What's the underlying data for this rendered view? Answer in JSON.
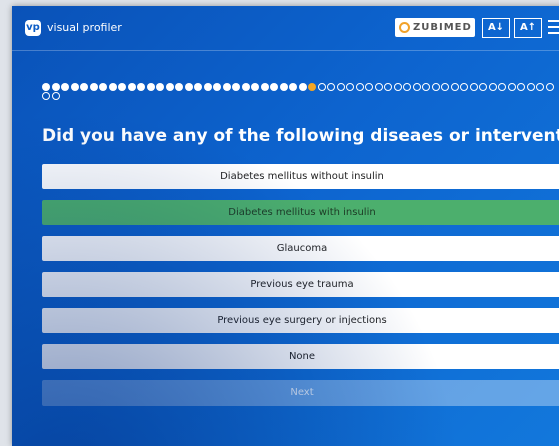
{
  "header": {
    "logo": "vp",
    "app_name": "visual profiler",
    "brand": "ZUBIMED",
    "font_smaller": "A↓",
    "font_larger": "A↑"
  },
  "progress": {
    "completed": 28,
    "current": 29,
    "total": 56,
    "colors": {
      "done": "#ffffff",
      "current": "#f5a623"
    }
  },
  "question": "Did you have any of the following diseaes or interventions?",
  "options": [
    {
      "label": "Diabetes mellitus without insulin",
      "selected": false
    },
    {
      "label": "Diabetes mellitus with insulin",
      "selected": true
    },
    {
      "label": "Glaucoma",
      "selected": false
    },
    {
      "label": "Previous eye trauma",
      "selected": false
    },
    {
      "label": "Previous eye surgery or injections",
      "selected": false
    },
    {
      "label": "None",
      "selected": false
    }
  ],
  "next_label": "Next",
  "colors": {
    "background": "#0d64cf",
    "selected": "#4caf6d"
  }
}
